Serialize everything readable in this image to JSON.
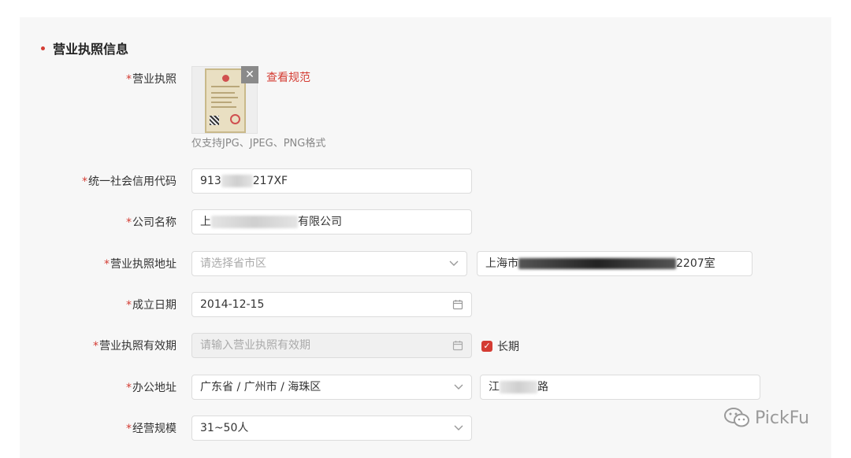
{
  "section": {
    "title": "营业执照信息"
  },
  "fields": {
    "license": {
      "label": "营业执照",
      "view_spec": "查看规范",
      "hint": "仅支持JPG、JPEG、PNG格式"
    },
    "credit_code": {
      "label": "统一社会信用代码",
      "value_prefix": "913",
      "value_suffix": "217XF"
    },
    "company_name": {
      "label": "公司名称",
      "value_prefix": "上",
      "value_suffix": "有限公司"
    },
    "license_address": {
      "label": "营业执照地址",
      "region_placeholder": "请选择省市区",
      "detail_prefix": "上海市",
      "detail_suffix": "2207室"
    },
    "established_date": {
      "label": "成立日期",
      "value": "2014-12-15"
    },
    "license_validity": {
      "label": "营业执照有效期",
      "placeholder": "请输入营业执照有效期",
      "long_term_label": "长期"
    },
    "office_address": {
      "label": "办公地址",
      "region_value": "广东省 / 广州市 / 海珠区",
      "detail_prefix": "江",
      "detail_suffix": "路"
    },
    "business_scale": {
      "label": "经营规模",
      "value": "31~50人"
    }
  },
  "watermark": {
    "text": "PickFu"
  },
  "colors": {
    "accent": "#d43c33",
    "border": "#dcdcdc",
    "panel": "#f7f7f7"
  }
}
